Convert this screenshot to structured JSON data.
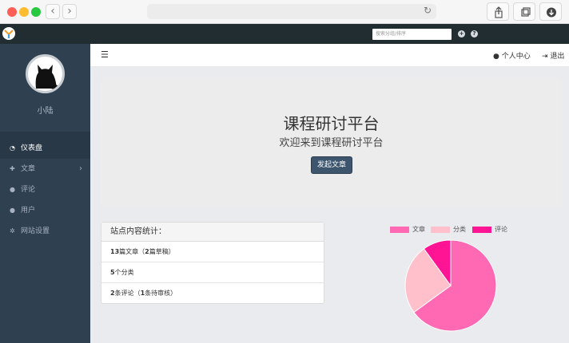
{
  "topbar": {
    "search_placeholder": "搜索分组/排序"
  },
  "sidebar": {
    "username": "小陆",
    "items": [
      {
        "label": "仪表盘",
        "icon": "dashboard-icon",
        "active": true
      },
      {
        "label": "文章",
        "icon": "pin-icon",
        "has_submenu": true
      },
      {
        "label": "评论",
        "icon": "comments-icon"
      },
      {
        "label": "用户",
        "icon": "users-icon"
      },
      {
        "label": "网站设置",
        "icon": "cogs-icon"
      }
    ]
  },
  "header": {
    "profile_label": "个人中心",
    "logout_label": "退出"
  },
  "jumbotron": {
    "title": "课程研讨平台",
    "subtitle": "欢迎来到课程研讨平台",
    "button_label": "发起文章"
  },
  "stats": {
    "heading": "站点内容统计：",
    "row1": {
      "count": "13",
      "mid": "篇文章（",
      "drafts": "2",
      "tail": "篇草稿）"
    },
    "row2": {
      "count": "5",
      "tail": "个分类"
    },
    "row3": {
      "count": "2",
      "mid": "条评论（",
      "pending": "1",
      "tail": "条待审核）"
    }
  },
  "chart_data": {
    "type": "pie",
    "categories": [
      "文章",
      "分类",
      "评论"
    ],
    "values": [
      13,
      5,
      2
    ],
    "colors": [
      "#ff69b4",
      "#ffc0cb",
      "#ff1493"
    ],
    "legend_position": "top"
  }
}
